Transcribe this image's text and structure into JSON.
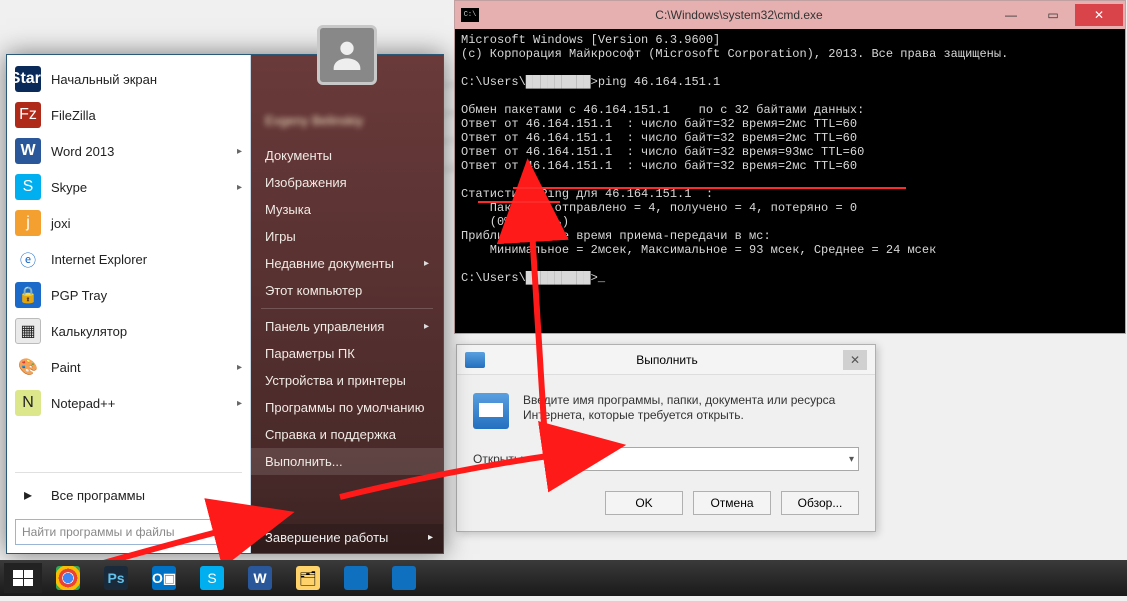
{
  "cmd": {
    "title": "C:\\Windows\\system32\\cmd.exe",
    "lines": [
      "Microsoft Windows [Version 6.3.9600]",
      "(c) Корпорация Майкрософт (Microsoft Corporation), 2013. Все права защищены.",
      "",
      "C:\\Users\\█████████>ping 46.164.151.1",
      "",
      "Обмен пакетами с 46.164.151.1    по с 32 байтами данных:",
      "Ответ от 46.164.151.1  : число байт=32 время=2мс TTL=60",
      "Ответ от 46.164.151.1  : число байт=32 время=2мс TTL=60",
      "Ответ от 46.164.151.1  : число байт=32 время=93мс TTL=60",
      "Ответ от 46.164.151.1  : число байт=32 время=2мс TTL=60",
      "",
      "Статистика Ping для 46.164.151.1  :",
      "    Пакетов: отправлено = 4, получено = 4, потеряно = 0",
      "    (0% потерь)",
      "Приблизительное время приема-передачи в мс:",
      "    Минимальное = 2мсек, Максимальное = 93 мсек, Среднее = 24 мсек",
      "",
      "C:\\Users\\█████████>_"
    ]
  },
  "run": {
    "title": "Выполнить",
    "instruction": "Введите имя программы, папки, документа или ресурса Интернета, которые требуется открыть.",
    "open_label": "Открыть:",
    "value": "cmd",
    "ok": "OK",
    "cancel": "Отмена",
    "browse": "Обзор..."
  },
  "start_menu": {
    "user_name": "Evgeny Belinskiy",
    "left": [
      {
        "label": "Начальный экран",
        "icon": "start"
      },
      {
        "label": "FileZilla",
        "icon": "fz"
      },
      {
        "label": "Word 2013",
        "icon": "word",
        "has_sub": true
      },
      {
        "label": "Skype",
        "icon": "skype",
        "has_sub": true
      },
      {
        "label": "joxi",
        "icon": "joxi"
      },
      {
        "label": "Internet Explorer",
        "icon": "ie"
      },
      {
        "label": "PGP Tray",
        "icon": "pgp"
      },
      {
        "label": "Калькулятор",
        "icon": "calc"
      },
      {
        "label": "Paint",
        "icon": "paint",
        "has_sub": true
      },
      {
        "label": "Notepad++",
        "icon": "npp",
        "has_sub": true
      }
    ],
    "all_programs": "Все программы",
    "search_placeholder": "Найти программы и файлы",
    "right": [
      {
        "label": "Документы"
      },
      {
        "label": "Изображения"
      },
      {
        "label": "Музыка"
      },
      {
        "label": "Игры"
      },
      {
        "label": "Недавние документы",
        "has_sub": true
      },
      {
        "label": "Этот компьютер"
      },
      {
        "sep": true
      },
      {
        "label": "Панель управления",
        "has_sub": true
      },
      {
        "label": "Параметры ПК"
      },
      {
        "label": "Устройства и принтеры"
      },
      {
        "label": "Программы по умолчанию"
      },
      {
        "label": "Справка и поддержка"
      },
      {
        "label": "Выполнить...",
        "sel": true
      }
    ],
    "shutdown": "Завершение работы"
  },
  "taskbar": {
    "items": [
      {
        "name": "chrome",
        "icon": "chrome"
      },
      {
        "name": "photoshop",
        "icon": "ps"
      },
      {
        "name": "outlook",
        "icon": "outlook"
      },
      {
        "name": "skype",
        "icon": "skype"
      },
      {
        "name": "word",
        "icon": "word"
      },
      {
        "name": "explorer",
        "icon": "explorer"
      },
      {
        "name": "tile1",
        "icon": "tile"
      },
      {
        "name": "tile2",
        "icon": "tile"
      }
    ]
  }
}
